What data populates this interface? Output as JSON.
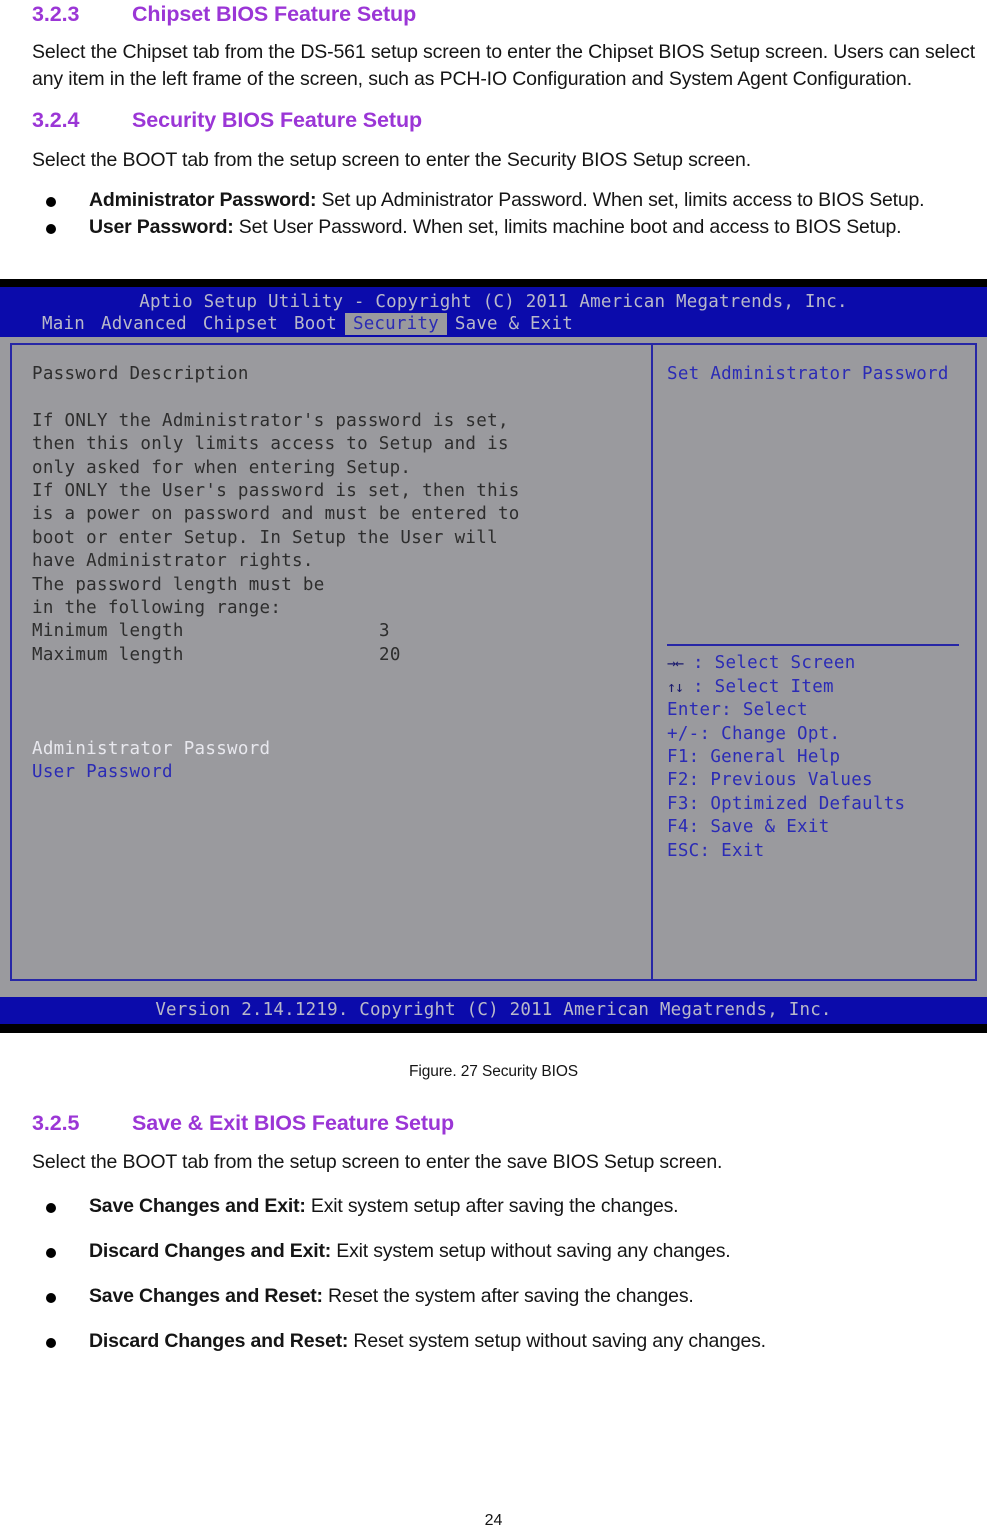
{
  "document": {
    "sections": [
      {
        "number": "3.2.3",
        "title": "Chipset BIOS Feature Setup",
        "paragraph": "Select the Chipset tab from the DS-561 setup screen to enter the Chipset BIOS Setup screen. Users can select any item in the left frame of the screen, such as PCH-IO Configuration and System Agent Configuration."
      },
      {
        "number": "3.2.4",
        "title": "Security BIOS Feature Setup",
        "paragraph": "Select the BOOT tab from the setup screen to enter the Security BIOS Setup screen.",
        "bullets": [
          {
            "term": "Administrator Password:",
            "text": " Set up Administrator Password. When set, limits access to BIOS Setup."
          },
          {
            "term": "User Password:",
            "text": " Set User Password. When set, limits machine boot and access to BIOS Setup."
          }
        ]
      },
      {
        "number": "3.2.5",
        "title": "Save & Exit BIOS Feature Setup",
        "paragraph": "Select the BOOT tab from the setup screen to enter the save BIOS Setup screen.",
        "bullets": [
          {
            "term": "Save Changes and Exit:",
            "text": " Exit system setup after saving the changes."
          },
          {
            "term": "Discard Changes and Exit:",
            "text": " Exit system setup without saving any changes."
          },
          {
            "term": "Save Changes and Reset:",
            "text": " Reset the system after saving the changes."
          },
          {
            "term": "Discard Changes and Reset:",
            "text": " Reset system setup without saving any changes."
          }
        ]
      }
    ],
    "figure_caption": "Figure. 27 Security BIOS",
    "page_number": "24"
  },
  "bios": {
    "title": "Aptio Setup Utility - Copyright (C) 2011 American Megatrends, Inc.",
    "tabs": [
      {
        "label": "Main",
        "active": false
      },
      {
        "label": "Advanced",
        "active": false
      },
      {
        "label": "Chipset",
        "active": false
      },
      {
        "label": "Boot",
        "active": false
      },
      {
        "label": "Security",
        "active": true
      },
      {
        "label": "Save & Exit",
        "active": false
      }
    ],
    "left_pane": {
      "heading": "Password Description",
      "description_lines": [
        "If ONLY the Administrator's password is set,",
        "then this only limits access to Setup and is",
        "only asked for when entering Setup.",
        "If ONLY the User's password is set, then this",
        "is a power on password and must be entered to",
        "boot or enter Setup. In Setup the User will",
        "have Administrator rights.",
        "The password length must be",
        "in the following range:"
      ],
      "length_rows": [
        {
          "label": "Minimum length",
          "value": "3"
        },
        {
          "label": "Maximum length",
          "value": "20"
        }
      ],
      "menu_items": [
        {
          "label": "Administrator Password",
          "selected": true
        },
        {
          "label": "User Password",
          "selected": false
        }
      ]
    },
    "right_pane": {
      "help_title": "Set Administrator Password",
      "keys": [
        {
          "glyph": "→←",
          "text": ": Select Screen"
        },
        {
          "glyph": "↑↓",
          "text": ": Select Item"
        },
        {
          "glyph": "",
          "text": "Enter: Select"
        },
        {
          "glyph": "",
          "text": "+/-: Change Opt."
        },
        {
          "glyph": "",
          "text": "F1: General Help"
        },
        {
          "glyph": "",
          "text": "F2: Previous Values"
        },
        {
          "glyph": "",
          "text": "F3: Optimized Defaults"
        },
        {
          "glyph": "",
          "text": "F4: Save & Exit"
        },
        {
          "glyph": "",
          "text": "ESC: Exit"
        }
      ]
    },
    "version_bar": "Version 2.14.1219. Copyright (C) 2011 American Megatrends, Inc.",
    "colors": {
      "header_blue": "#0b0bab",
      "panel_gray": "#9a9a9e",
      "frame_blue": "#2727a6",
      "text_blue": "#2b2bb5",
      "header_text": "#b9b9c9"
    }
  }
}
